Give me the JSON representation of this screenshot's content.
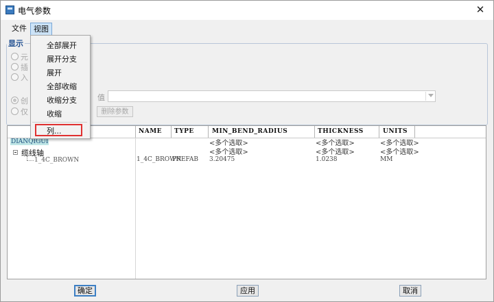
{
  "window": {
    "title": "电气参数",
    "close_symbol": "✕"
  },
  "menubar": {
    "file": "文件",
    "view": "视图"
  },
  "view_menu": {
    "items": [
      "全部展开",
      "展开分支",
      "展开",
      "全部收缩",
      "收缩分支",
      "收缩"
    ],
    "highlighted_item": "列...",
    "highlight_color": "#e03030"
  },
  "display_group": {
    "title": "显示",
    "radio_top": [
      "元",
      "插",
      "入"
    ],
    "radio_bottom": [
      "创",
      "仅"
    ],
    "value_label": "值",
    "value_input": "",
    "delete_param_button": "删除参数"
  },
  "table": {
    "columns": [
      "NAME",
      "TYPE",
      "MIN_BEND_RADIUS",
      "THICKNESS",
      "UNITS"
    ],
    "tree": {
      "root": "DIANQIGUI",
      "node": "缆线轴",
      "leaf": "1_4C_BROWN"
    },
    "rows": [
      {
        "name": "",
        "type": "",
        "min_bend_radius": "<多个选取>",
        "thickness": "<多个选取>",
        "units": "<多个选取>"
      },
      {
        "name": "",
        "type": "",
        "min_bend_radius": "<多个选取>",
        "thickness": "<多个选取>",
        "units": "<多个选取>"
      },
      {
        "name": "1_4C_BROWN",
        "type": "PREFAB",
        "min_bend_radius": "3.20475",
        "thickness": "1.0238",
        "units": "MM"
      }
    ]
  },
  "buttons": {
    "ok": "确定",
    "apply": "应用",
    "cancel": "取消"
  }
}
